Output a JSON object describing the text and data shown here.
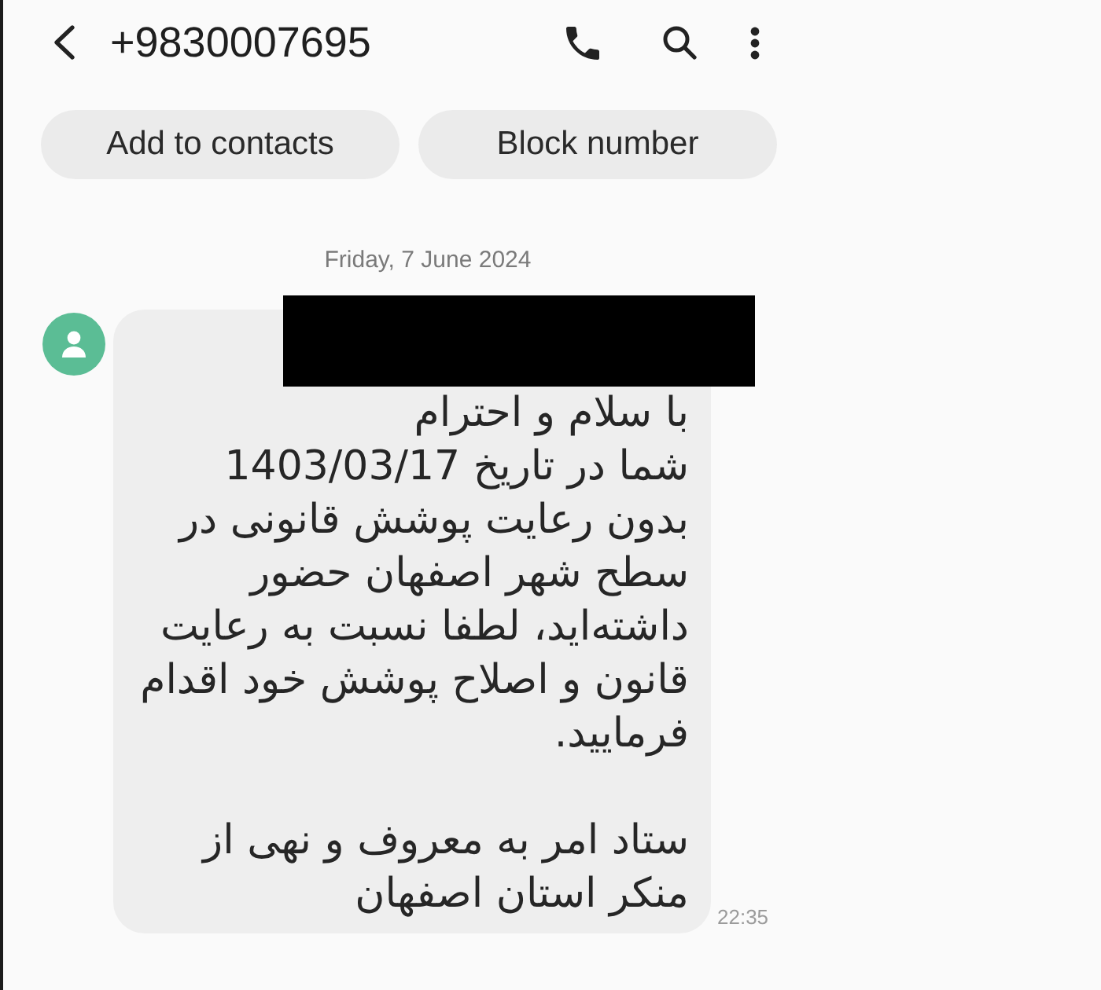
{
  "header": {
    "title": "+9830007695"
  },
  "contact_actions": {
    "add_to_contacts": {
      "label": "Add to contacts"
    },
    "block_number": {
      "label": "Block number"
    }
  },
  "date_divider": "Friday, 7 June 2024",
  "messages": [
    {
      "kind": "incoming",
      "redacted": true,
      "text": "با سلام و احترام\nشما در تاریخ 1403/03/17 بدون رعایت پوشش قانونی در سطح شهر اصفهان حضور داشته‌اید، لطفا نسبت به رعایت قانون و اصلاح پوشش خود اقدام فرمایید.\n\nستاد امر به معروف و نهی از منکر استان اصفهان",
      "time": "22:35"
    }
  ]
}
